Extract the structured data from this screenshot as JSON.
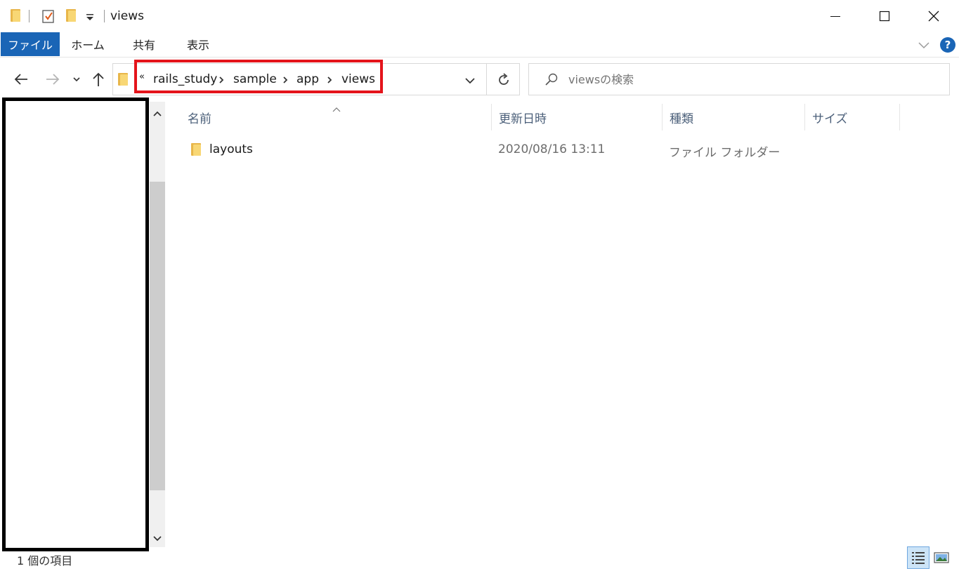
{
  "window": {
    "title": "views",
    "minimize_icon": "minimize-icon",
    "maximize_icon": "maximize-icon",
    "close_icon": "close-icon"
  },
  "ribbon": {
    "tabs": [
      {
        "label": "ファイル"
      },
      {
        "label": "ホーム"
      },
      {
        "label": "共有"
      },
      {
        "label": "表示"
      }
    ],
    "help_label": "?"
  },
  "address": {
    "overflow": "«",
    "breadcrumbs": [
      "rails_study",
      "sample",
      "app",
      "views"
    ]
  },
  "search": {
    "placeholder": "viewsの検索"
  },
  "list": {
    "columns": [
      "名前",
      "更新日時",
      "種類",
      "サイズ"
    ],
    "rows": [
      {
        "name": "layouts",
        "modified": "2020/08/16 13:11",
        "type": "ファイル フォルダー",
        "size": ""
      }
    ]
  },
  "status": {
    "item_count": "1 個の項目"
  },
  "colors": {
    "accent": "#1a65b6",
    "highlight_red": "#e4141b",
    "folder": "#f8d775"
  }
}
